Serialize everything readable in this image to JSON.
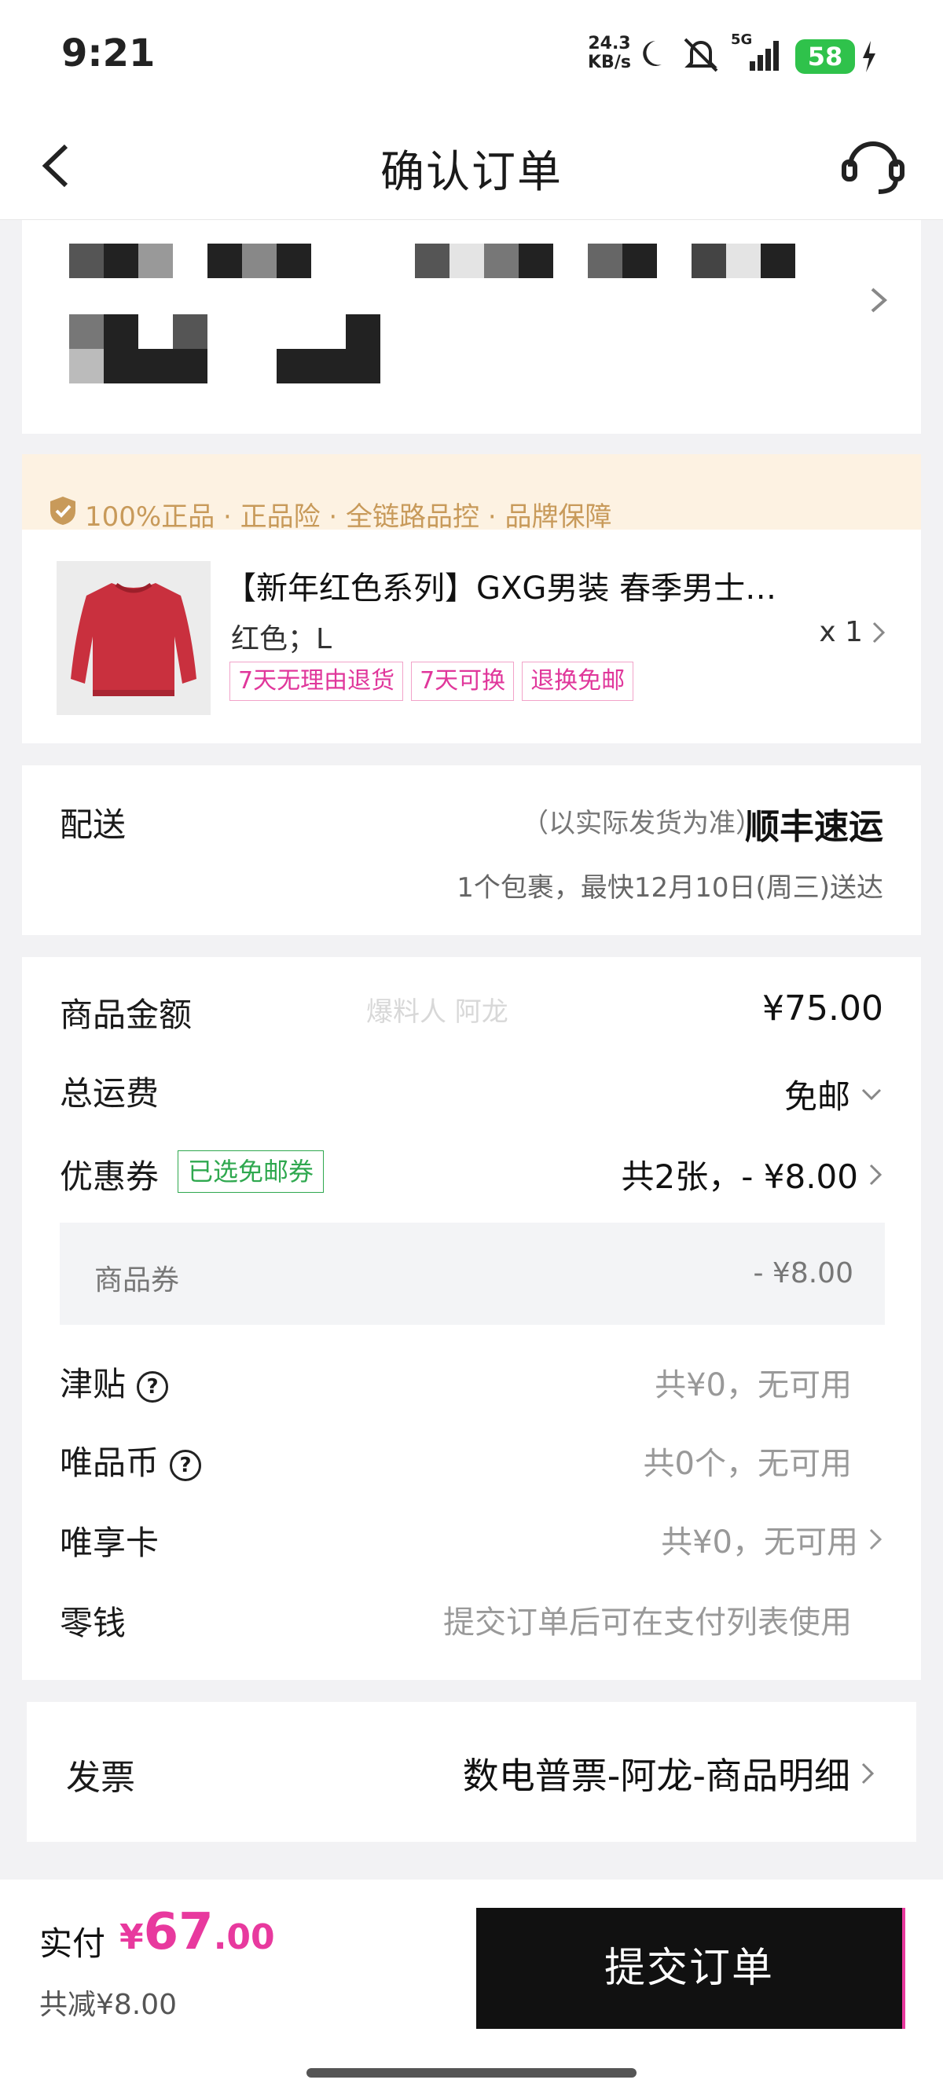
{
  "status_bar": {
    "time": "9:21",
    "net_speed_value": "24.3",
    "net_speed_unit": "KB/s",
    "network": "5G",
    "battery": "58"
  },
  "nav": {
    "title": "确认订单"
  },
  "guarantee": {
    "text": "100%正品 · 正品险 · 全链路品控 · 品牌保障"
  },
  "product": {
    "title": "【新年红色系列】GXG男装 春季男士…",
    "spec": "红色；L",
    "qty": "x 1",
    "tags": [
      "7天无理由退货",
      "7天可换",
      "退换免邮"
    ]
  },
  "delivery": {
    "label": "配送",
    "note": "（以实际发货为准）",
    "carrier": "顺丰速运",
    "eta": "1个包裹，最快12月10日(周三)送达"
  },
  "price": {
    "goods_label": "商品金额",
    "goods_value": "¥75.00",
    "watermark": "爆料人 阿龙",
    "shipping_label": "总运费",
    "shipping_value": "免邮",
    "coupon_label": "优惠券",
    "coupon_tag": "已选免邮券",
    "coupon_value": "共2张，- ¥8.00",
    "sub_label": "商品券",
    "sub_value": "- ¥8.00",
    "subsidy_label": "津贴",
    "subsidy_value": "共¥0，无可用",
    "coin_label": "唯品币",
    "coin_value": "共0个，无可用",
    "card_label": "唯享卡",
    "card_value": "共¥0，无可用",
    "change_label": "零钱",
    "change_value": "提交订单后可在支付列表使用"
  },
  "invoice": {
    "label": "发票",
    "value": "数电普票-阿龙-商品明细"
  },
  "footer": {
    "pay_label": "实付",
    "currency": "¥",
    "amount_int": "67",
    "amount_dec": ".00",
    "saved": "共减¥8.00",
    "submit": "提交订单"
  },
  "colors": {
    "accent": "#e8399e",
    "green": "#2fa84f",
    "gold": "#c89a5a"
  }
}
